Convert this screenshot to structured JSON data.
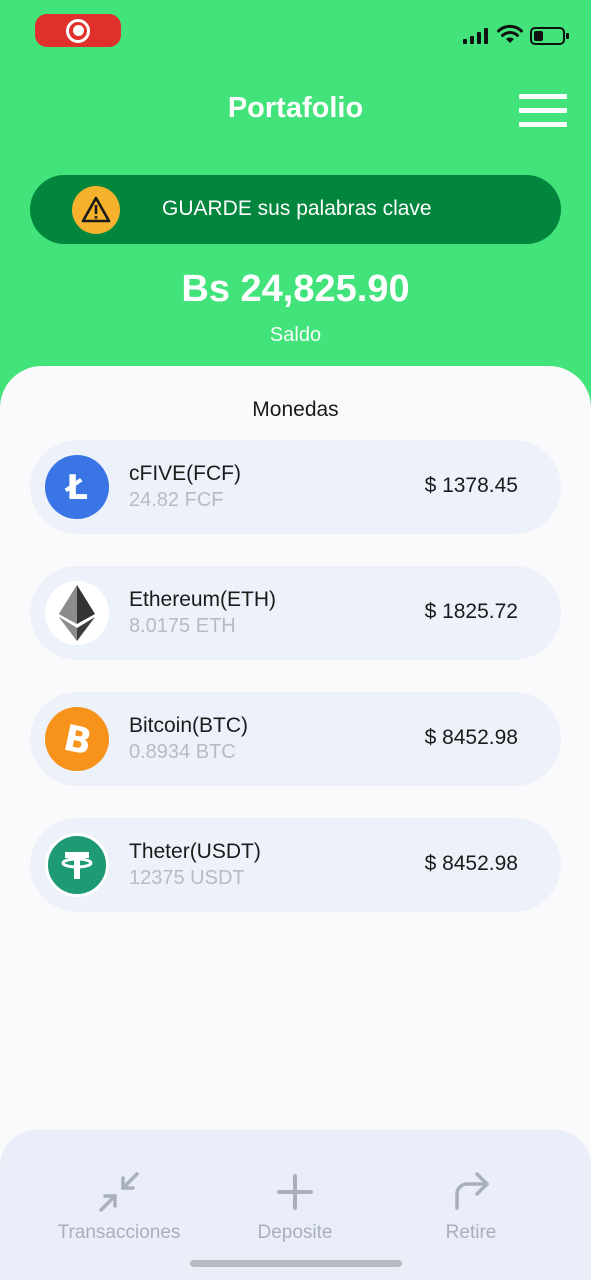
{
  "status_bar": {
    "recording_icon": "record-icon",
    "signal_icon": "cellular-signal-icon",
    "wifi_icon": "wifi-icon",
    "battery_icon": "battery-icon"
  },
  "header": {
    "title": "Portafolio",
    "menu_icon": "hamburger-menu-icon"
  },
  "warning": {
    "icon": "warning-icon",
    "text": "GUARDE sus palabras clave"
  },
  "balance": {
    "amount": "Bs 24,825.90",
    "label": "Saldo"
  },
  "coins_section": {
    "title": "Monedas",
    "items": [
      {
        "name": "cFIVE(FCF)",
        "quantity": "24.82 FCF",
        "value": "$ 1378.45",
        "icon": "litecoin-icon",
        "color": "#3a75e6"
      },
      {
        "name": "Ethereum(ETH)",
        "quantity": "8.0175 ETH",
        "value": "$ 1825.72",
        "icon": "ethereum-icon",
        "color": "#ffffff"
      },
      {
        "name": "Bitcoin(BTC)",
        "quantity": "0.8934 BTC",
        "value": "$ 8452.98",
        "icon": "bitcoin-icon",
        "color": "#f7931a"
      },
      {
        "name": "Theter(USDT)",
        "quantity": "12375 USDT",
        "value": "$ 8452.98",
        "icon": "tether-icon",
        "color": "#1e9a75"
      }
    ]
  },
  "bottom_nav": {
    "items": [
      {
        "label": "Transacciones",
        "icon": "collapse-arrows-icon"
      },
      {
        "label": "Deposite",
        "icon": "plus-icon"
      },
      {
        "label": "Retire",
        "icon": "share-arrow-icon"
      }
    ]
  },
  "colors": {
    "accent_green": "#42e37a",
    "banner_green": "#02853c",
    "warning_yellow": "#f6b22c"
  }
}
